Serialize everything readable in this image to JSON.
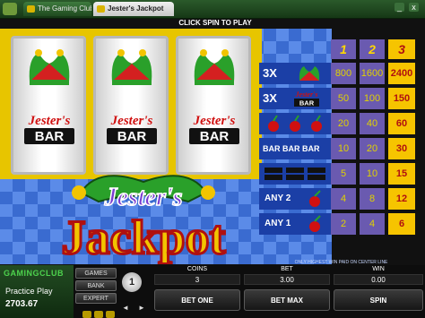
{
  "tabs": [
    {
      "label": "The Gaming Club"
    },
    {
      "label": "Jester's Jackpot"
    }
  ],
  "status_message": "CLICK SPIN TO PLAY",
  "window_controls": {
    "minimize": "_",
    "close": "x"
  },
  "reels": [
    {
      "top": "Jester hat",
      "middle": "Jester's BAR"
    },
    {
      "top": "Jester hat",
      "middle": "Jester's BAR"
    },
    {
      "top": "Jester hat",
      "middle": "Jester's BAR"
    }
  ],
  "game_logo": {
    "line1": "Jester's",
    "line2": "Jackpot"
  },
  "paytable": {
    "headers": [
      "1",
      "2",
      "3"
    ],
    "rows": [
      {
        "symbol": "3X",
        "icon": "jester-hat-icon",
        "payouts": [
          "800",
          "1600",
          "2400"
        ]
      },
      {
        "symbol": "3X",
        "icon": "jesters-bar-icon",
        "payouts": [
          "50",
          "100",
          "150"
        ]
      },
      {
        "symbol": "",
        "icon": "cherries-icon",
        "payouts": [
          "20",
          "40",
          "60"
        ]
      },
      {
        "symbol": "BAR BAR BAR",
        "icon": "",
        "payouts": [
          "10",
          "20",
          "30"
        ]
      },
      {
        "symbol": "",
        "icon": "any-bar-icon",
        "payouts": [
          "5",
          "10",
          "15"
        ]
      },
      {
        "symbol": "ANY 2",
        "icon": "cherry-icon",
        "payouts": [
          "4",
          "8",
          "12"
        ]
      },
      {
        "symbol": "ANY 1",
        "icon": "cherry-icon",
        "payouts": [
          "2",
          "4",
          "6"
        ]
      }
    ],
    "note": "ONLY HIGHEST WIN PAID ON CENTER LINE"
  },
  "sidebar": {
    "brand": "GAMINGCLUB",
    "mode": "Practice Play",
    "balance": "2703.67",
    "buttons": [
      "GAMES",
      "BANK",
      "EXPERT"
    ],
    "coin_value": "1"
  },
  "bet_panel": {
    "coins_label": "COINS",
    "coins_value": "3",
    "bet_label": "BET",
    "bet_value": "3.00",
    "win_label": "WIN",
    "win_value": "0.00",
    "bet_one": "BET ONE",
    "bet_max": "BET MAX",
    "spin": "SPIN"
  },
  "colors": {
    "frame_yellow": "#e7c500",
    "diamond_blue": "#3a6bd0",
    "paytable_col": "#6a5ab0",
    "paytable_gold": "#f6c400"
  }
}
